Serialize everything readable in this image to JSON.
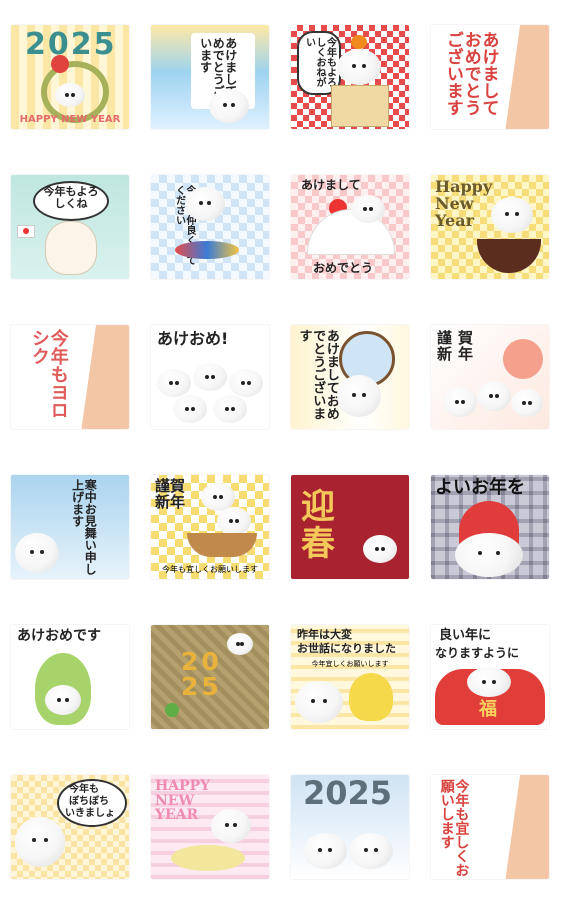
{
  "stickers": [
    {
      "id": "s1",
      "title": "2025",
      "subtitle": "HAPPY NEW YEAR"
    },
    {
      "id": "s2",
      "text": "あけましておめでとうございます"
    },
    {
      "id": "s3",
      "text": "今年もよろしくおねがい"
    },
    {
      "id": "s4",
      "text": "あけましておめでとうございます"
    },
    {
      "id": "s5",
      "text": "今年もよろしくね"
    },
    {
      "id": "s6",
      "text": "今年も仲良くしてください"
    },
    {
      "id": "s7",
      "top": "あけまして",
      "bottom": "おめでとう"
    },
    {
      "id": "s8",
      "text": "Happy New Year"
    },
    {
      "id": "s9",
      "text": "今年もヨロシク"
    },
    {
      "id": "s10",
      "text": "あけおめ!"
    },
    {
      "id": "s11",
      "text": "あけましておめでとうございます"
    },
    {
      "id": "s12",
      "text": "謹賀新年"
    },
    {
      "id": "s13",
      "text": "寒中お見舞い申し上げます"
    },
    {
      "id": "s14",
      "title": "謹賀新年",
      "caption": "今年も宜しくお願いします"
    },
    {
      "id": "s15",
      "text": "迎春"
    },
    {
      "id": "s16",
      "text": "よいお年を"
    },
    {
      "id": "s17",
      "text": "あけおめです"
    },
    {
      "id": "s18",
      "text": "2025"
    },
    {
      "id": "s19",
      "line1": "昨年は大変",
      "line2": "お世話になりました",
      "caption": "今年宜しくお願いします"
    },
    {
      "id": "s20",
      "line1": "良い年に",
      "line2": "なりますように",
      "tag": "福"
    },
    {
      "id": "s21",
      "line1": "今年も",
      "line2": "ぼちぼち",
      "line3": "いきましょ"
    },
    {
      "id": "s22",
      "text": "HAPPY NEW YEAR"
    },
    {
      "id": "s23",
      "text": "2025"
    },
    {
      "id": "s24",
      "text": "今年も宜しくお願いします"
    }
  ]
}
